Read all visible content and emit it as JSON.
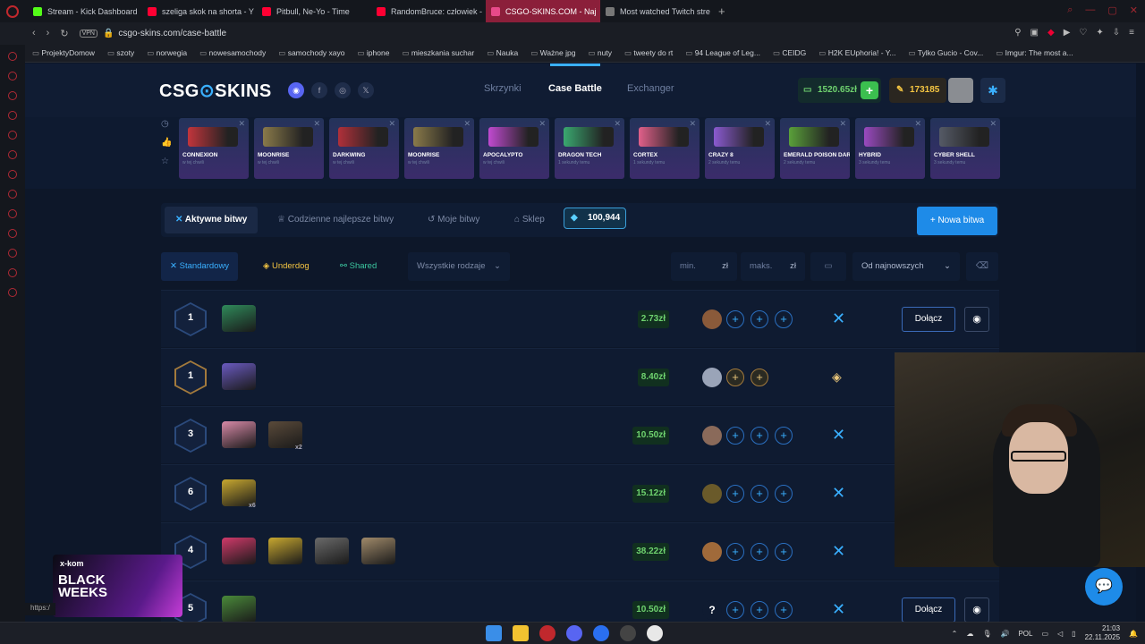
{
  "browser": {
    "tabs": [
      {
        "label": "Stream - Kick Dashboard",
        "color": "#53fc18"
      },
      {
        "label": "szeliga skok na shorta - Y",
        "color": "#ff0033"
      },
      {
        "label": "Pitbull, Ne-Yo - Time",
        "color": "#ff0033"
      },
      {
        "label": "RandomBruce: człowiek -",
        "color": "#ff0033"
      },
      {
        "label": "CSGO-SKINS.COM - Naj",
        "color": "#e84a8a",
        "active": true
      },
      {
        "label": "Most watched Twitch stre",
        "color": "#777777"
      }
    ],
    "vpn": "VPN",
    "url": "csgo-skins.com/case-battle",
    "bookmarks": [
      "ProjektyDomow",
      "szoty",
      "norwegia",
      "nowesamochody",
      "samochody xayo",
      "iphone",
      "mieszkania suchar",
      "Nauka",
      "Ważne jpg",
      "nuty",
      "tweety do rt",
      "94 League of Leg...",
      "CEIDG",
      "H2K EUphoria! - Y...",
      "Tylko Gucio - Cov...",
      "Imgur: The most a..."
    ]
  },
  "header": {
    "brand_a": "CSG",
    "brand_b": "SKINS",
    "nav": [
      "Skrzynki",
      "Case Battle",
      "Exchanger"
    ],
    "balance": "1520.65zł",
    "coins": "173185"
  },
  "drops": [
    {
      "name": "CONNEXION",
      "time": "w tej chwili",
      "color": "#c2353c"
    },
    {
      "name": "MOONRISE",
      "time": "w tej chwili",
      "color": "#8a7a4a"
    },
    {
      "name": "DARKWING",
      "time": "w tej chwili",
      "color": "#b0303a"
    },
    {
      "name": "MOONRISE",
      "time": "w tej chwili",
      "color": "#8a7a4a"
    },
    {
      "name": "APOCALYPTO",
      "time": "w tej chwili",
      "color": "#c04ad0"
    },
    {
      "name": "DRAGON TECH",
      "time": "1 sekundy temu",
      "color": "#3aa870"
    },
    {
      "name": "CORTEX",
      "time": "1 sekundy temu",
      "color": "#e0608a"
    },
    {
      "name": "CRAZY 8",
      "time": "2 sekundy temu",
      "color": "#8a5ad0"
    },
    {
      "name": "EMERALD POISON DART",
      "time": "2 sekundy temu",
      "color": "#5aa03a"
    },
    {
      "name": "HYBRID",
      "time": "3 sekundy temu",
      "color": "#9a4ac0"
    },
    {
      "name": "CYBER SHELL",
      "time": "3 sekundy temu",
      "color": "#555a66"
    }
  ],
  "battle_tabs": {
    "active": "Aktywne bitwy",
    "daily": "Codzienne najlepsze bitwy",
    "mine": "Moje bitwy",
    "shop": "Sklep",
    "diamonds": "100,944",
    "new_battle": "+ Nowa bitwa"
  },
  "filters": {
    "standard": "Standardowy",
    "underdog": "Underdog",
    "shared": "Shared",
    "all_types": "Wszystkie rodzaje",
    "min_ph": "min.",
    "max_ph": "maks.",
    "currency": "zł",
    "sort": "Od najnowszych"
  },
  "rows": [
    {
      "rounds": "1",
      "price": "2.73zł",
      "cases": [
        {
          "color": "#2f8a5a"
        }
      ],
      "players": [
        {
          "color": "#8a5a3a"
        }
      ],
      "slots": 3,
      "mode": "standard",
      "join": "Dołącz",
      "eye": true
    },
    {
      "rounds": "1",
      "price": "8.40zł",
      "cases": [
        {
          "color": "#6a5ac0"
        }
      ],
      "players": [
        {
          "color": "#9aa4b8"
        }
      ],
      "slots": 2,
      "mode": "underdog",
      "gold": true
    },
    {
      "rounds": "3",
      "price": "10.50zł",
      "cases": [
        {
          "color": "#d88aa8"
        },
        {
          "color": "#5a4a3a",
          "count": "x2"
        }
      ],
      "players": [
        {
          "color": "#8a6a5a"
        }
      ],
      "slots": 3,
      "mode": "standard"
    },
    {
      "rounds": "6",
      "price": "15.12zł",
      "cases": [
        {
          "color": "#c8a830",
          "count": "x6"
        }
      ],
      "players": [
        {
          "color": "#6a5a2a"
        }
      ],
      "slots": 3,
      "mode": "standard"
    },
    {
      "rounds": "4",
      "price": "38.22zł",
      "cases": [
        {
          "color": "#d03a6a"
        },
        {
          "color": "#c8a830"
        },
        {
          "color": "#6a6a6a"
        },
        {
          "color": "#a08a6a"
        }
      ],
      "players": [
        {
          "color": "#a06a3a"
        }
      ],
      "slots": 3,
      "mode": "standard"
    },
    {
      "rounds": "5",
      "price": "10.50zł",
      "cases": [
        {
          "color": "#4a8a3a"
        }
      ],
      "players": [
        {
          "color": "#0f1b31",
          "label": "?"
        }
      ],
      "slots": 3,
      "mode": "standard",
      "join": "Dołącz",
      "eye": true
    }
  ],
  "ad": {
    "brand": "x-kom",
    "headline": "BLACK WEEKS"
  },
  "status_url": "https:/",
  "tray": {
    "lang": "POL",
    "time": "21:03",
    "date": "22.11.2025"
  }
}
